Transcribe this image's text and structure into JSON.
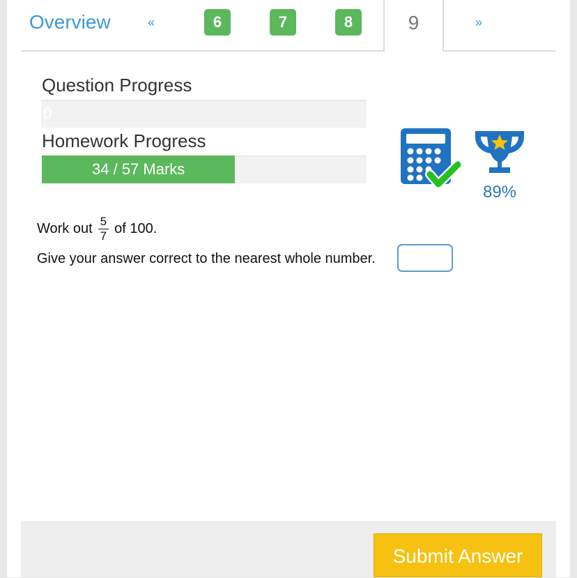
{
  "tabs": {
    "overview_label": "Overview",
    "prev_label": "«",
    "next_label": "»",
    "completed": [
      "6",
      "7",
      "8"
    ],
    "active": "9"
  },
  "progress": {
    "question_label": "Question Progress",
    "question_value_text": "0",
    "question_fraction": 0,
    "homework_label": "Homework Progress",
    "homework_value_text": "34 / 57 Marks",
    "homework_marks": 34,
    "homework_total": 57
  },
  "icons": {
    "calculator": "calculator-check-icon",
    "trophy": "trophy-star-icon"
  },
  "score_text": "89%",
  "question": {
    "prefix": "Work out",
    "fraction_numerator": "5",
    "fraction_denominator": "7",
    "suffix": "of 100.",
    "instruction": "Give your answer correct to the nearest whole number.",
    "answer_value": ""
  },
  "footer": {
    "submit_label": "Submit Answer"
  },
  "colors": {
    "accent_blue": "#3a9ad9",
    "success_green": "#5cb85c",
    "submit_yellow": "#f6c110",
    "icon_blue": "#1f73c1"
  }
}
